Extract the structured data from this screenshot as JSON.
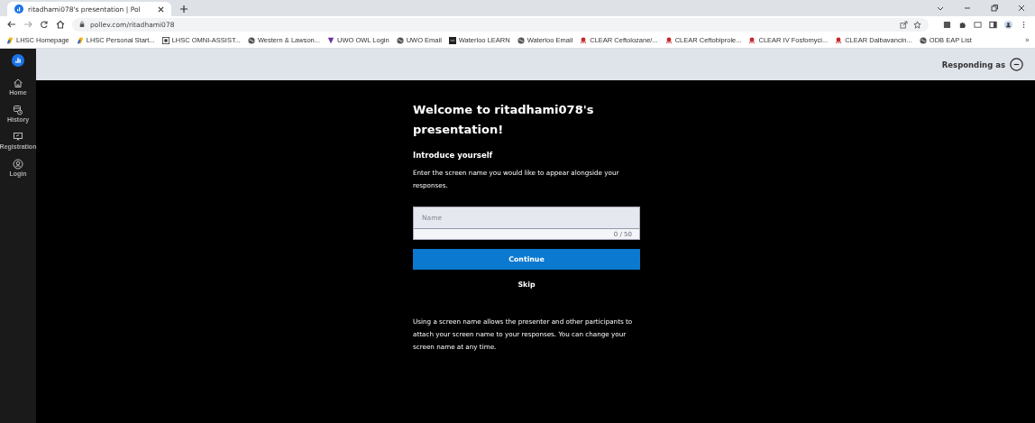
{
  "browser": {
    "tab": {
      "title": "ritadhami078's presentation | Pol",
      "selected": true
    },
    "url": "pollev.com/ritadhami078",
    "bookmarks": [
      {
        "label": "LHSC Homepage",
        "kind": "lhsc"
      },
      {
        "label": "LHSC Personal Start...",
        "kind": "lhsc"
      },
      {
        "label": "LHSC OMNI-ASSIST...",
        "kind": "omni"
      },
      {
        "label": "Western & Lawson...",
        "kind": "globe"
      },
      {
        "label": "UWO OWL Login",
        "kind": "uwo"
      },
      {
        "label": "UWO Email",
        "kind": "globe"
      },
      {
        "label": "Waterloo LEARN",
        "kind": "learn"
      },
      {
        "label": "Waterloo Email",
        "kind": "globe"
      },
      {
        "label": "CLEAR Ceftolozane/...",
        "kind": "clear"
      },
      {
        "label": "CLEAR Ceftobiprole...",
        "kind": "clear"
      },
      {
        "label": "CLEAR IV Fosfomyci...",
        "kind": "clear"
      },
      {
        "label": "CLEAR Dalbavancin...",
        "kind": "clear"
      },
      {
        "label": "ODB EAP List",
        "kind": "globe"
      }
    ],
    "more": "»"
  },
  "sidebar": {
    "items": [
      {
        "label": "Home",
        "kind": "home"
      },
      {
        "label": "History",
        "kind": "history"
      },
      {
        "label": "Registration",
        "kind": "registration"
      },
      {
        "label": "Login",
        "kind": "login"
      }
    ]
  },
  "topbar": {
    "responding_as": "Responding as"
  },
  "form": {
    "title": "Welcome to ritadhami078's presentation!",
    "heading": "Introduce yourself",
    "description": "Enter the screen name you would like to appear alongside your responses.",
    "name_field": {
      "placeholder": "Name",
      "counter": "0 / 50"
    },
    "continue": "Continue",
    "skip": "Skip",
    "note": "Using a screen name allows the presenter and other participants to attach your screen name to your responses. You can change your screen name at any time."
  }
}
